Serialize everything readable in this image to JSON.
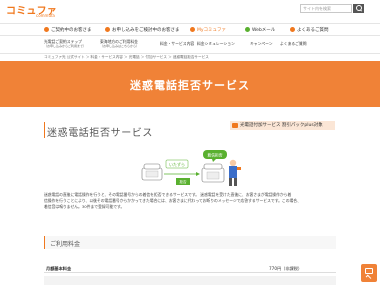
{
  "header": {
    "logo_text": "コミュファ",
    "logo_sub": "commufa",
    "search_placeholder": "サイト内を検索"
  },
  "nav1": [
    {
      "label": "ご契約中のお客さま",
      "dot": "orange"
    },
    {
      "label": "お申し込みをご検討中のお客さま",
      "dot": "orange"
    },
    {
      "label": "Myコミュファ",
      "dot": "orange",
      "emph": true
    },
    {
      "label": "Webメール",
      "dot": "green"
    },
    {
      "label": "よくあるご質問",
      "dot": "orange"
    }
  ],
  "nav2": [
    {
      "label": "光電話ご契約ステップ",
      "sub": "（お申し込みからご利用まで）"
    },
    {
      "label": "東海地方のご利用料金",
      "sub": "（お申し込みはこちらから）"
    },
    {
      "label": "料金・サービス内容"
    },
    {
      "label": "料金シミュレーション"
    },
    {
      "label": "キャンペーン"
    },
    {
      "label": "よくあるご質問"
    }
  ],
  "breadcrumb": "コミュファ光 公式サイト ＞ 料金・サービス内容 ＞ 光電話 ＞ 付加サービス ＞ 迷惑電話拒否サービス",
  "hero_title": "迷惑電話拒否サービス",
  "section": {
    "title": "迷惑電話拒否サービス",
    "badge": "光電話付加サービス 割引パックplus対象"
  },
  "illustration": {
    "caller_label": "いたずら",
    "msg_label": "拒否",
    "bubble_label": "着信拒否"
  },
  "description": [
    "迷惑電話の直後に電話操作を行うと、その電話番号からの着信を拒否できるサービスです。 迷惑電話を受けた直後に、お客さまが電話操作から着",
    "信操作を行うことにより、以後その電話番号からかかってきた場合には、お客さまに代わってお断りのメッセージで応答するサービスです。この場合、",
    "着信音は鳴りません。30件まで登録可能です。"
  ],
  "fee": {
    "title": "ご利用料金",
    "row_label": "月額基本料金",
    "row_value": "770円（非課税）"
  }
}
